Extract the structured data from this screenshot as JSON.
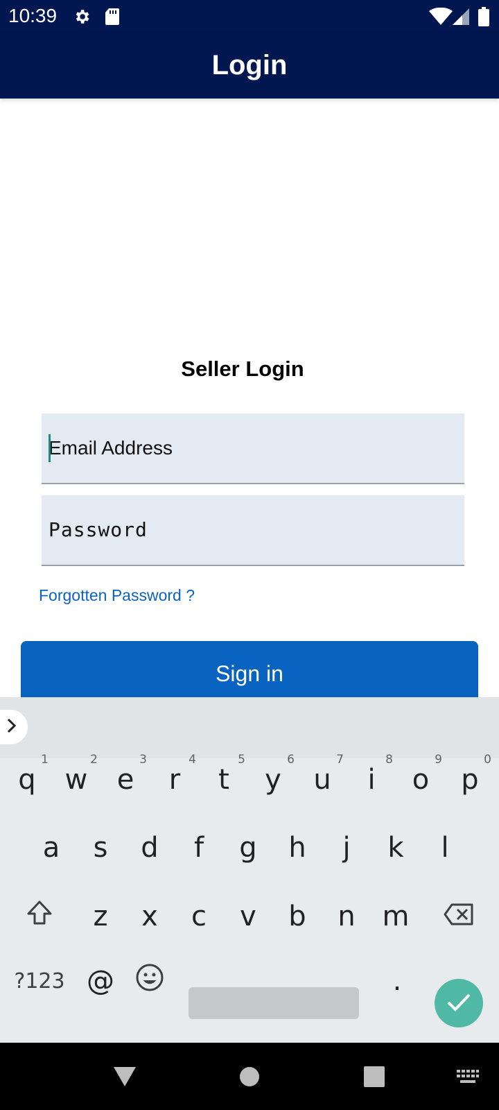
{
  "status_bar": {
    "time": "10:39",
    "icons": [
      "gear-icon",
      "sd-card-icon",
      "wifi-icon",
      "signal-icon",
      "battery-icon"
    ]
  },
  "app_bar": {
    "title": "Login"
  },
  "form": {
    "title": "Seller Login",
    "email": {
      "placeholder": "Email Address",
      "value": ""
    },
    "password": {
      "placeholder": "Password",
      "value": ""
    },
    "forgot_label": "Forgotten Password ?",
    "signin_label": "Sign in"
  },
  "keyboard": {
    "row1": [
      {
        "key": "q",
        "hint": "1"
      },
      {
        "key": "w",
        "hint": "2"
      },
      {
        "key": "e",
        "hint": "3"
      },
      {
        "key": "r",
        "hint": "4"
      },
      {
        "key": "t",
        "hint": "5"
      },
      {
        "key": "y",
        "hint": "6"
      },
      {
        "key": "u",
        "hint": "7"
      },
      {
        "key": "i",
        "hint": "8"
      },
      {
        "key": "o",
        "hint": "9"
      },
      {
        "key": "p",
        "hint": "0"
      }
    ],
    "row2": [
      "a",
      "s",
      "d",
      "f",
      "g",
      "h",
      "j",
      "k",
      "l"
    ],
    "row3": [
      "z",
      "x",
      "c",
      "v",
      "b",
      "n",
      "m"
    ],
    "symbols_label": "?123",
    "at_label": "@",
    "period_label": "."
  },
  "colors": {
    "app_bar": "#021650",
    "primary_button": "#0762c0",
    "link": "#0a63c0",
    "field_background": "#e3eaf1",
    "keyboard_done": "#4fb9a6"
  },
  "nav_bar": {
    "icons": [
      "back-icon",
      "home-icon",
      "recents-icon",
      "keyboard-switch-icon"
    ]
  }
}
